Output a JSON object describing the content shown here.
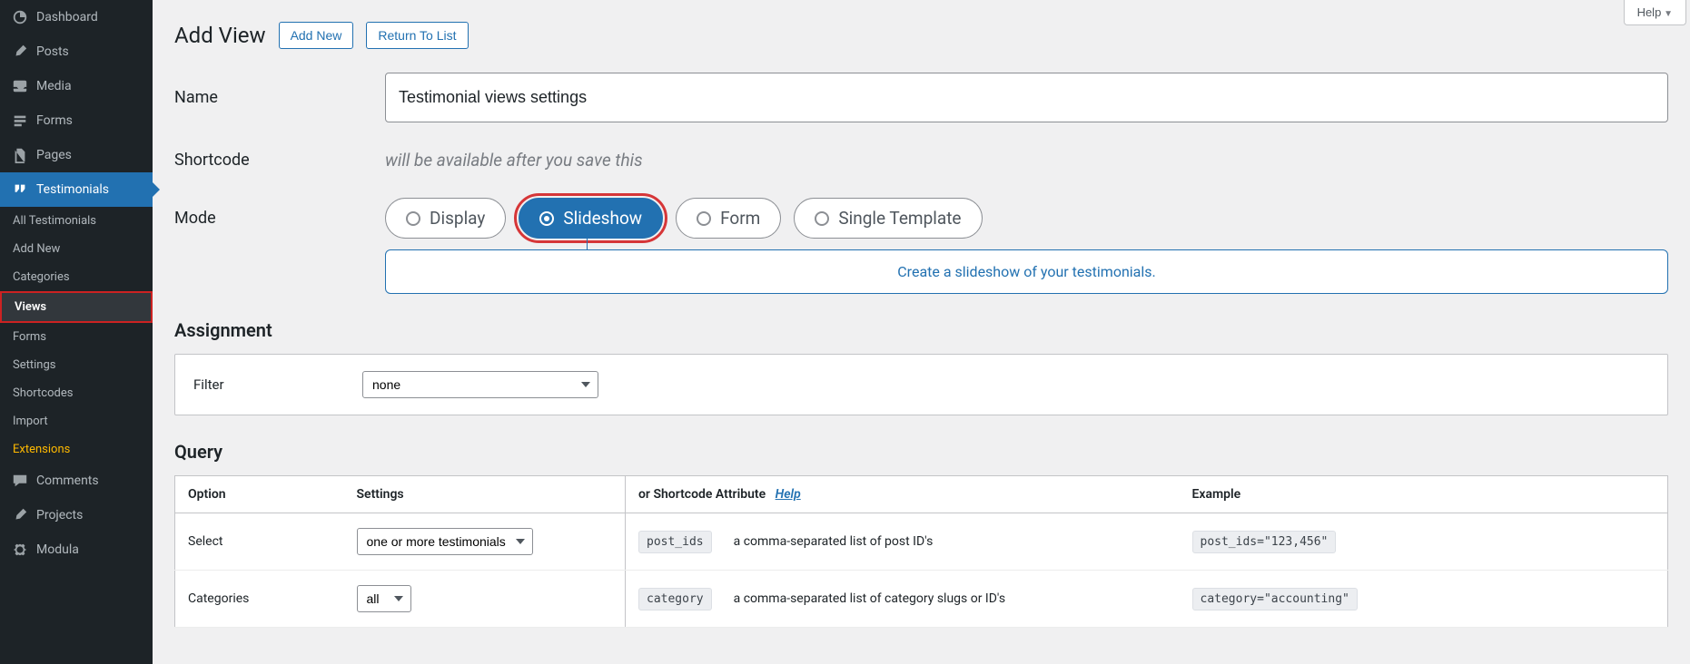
{
  "help_button": "Help",
  "sidebar": {
    "top": [
      {
        "icon": "dashboard",
        "label": "Dashboard"
      },
      {
        "icon": "pin",
        "label": "Posts"
      },
      {
        "icon": "media",
        "label": "Media"
      },
      {
        "icon": "forms",
        "label": "Forms"
      },
      {
        "icon": "pages",
        "label": "Pages"
      },
      {
        "icon": "quote",
        "label": "Testimonials"
      }
    ],
    "testimonials_sub": [
      "All Testimonials",
      "Add New",
      "Categories",
      "Views",
      "Forms",
      "Settings",
      "Shortcodes",
      "Import",
      "Extensions"
    ],
    "bottom": [
      {
        "icon": "comment",
        "label": "Comments"
      },
      {
        "icon": "pin",
        "label": "Projects"
      },
      {
        "icon": "gear",
        "label": "Modula"
      }
    ]
  },
  "header": {
    "title": "Add View",
    "add_new": "Add New",
    "return": "Return To List"
  },
  "name": {
    "label": "Name",
    "value": "Testimonial views settings"
  },
  "shortcode": {
    "label": "Shortcode",
    "msg": "will be available after you save this"
  },
  "mode": {
    "label": "Mode",
    "options": [
      "Display",
      "Slideshow",
      "Form",
      "Single Template"
    ],
    "selected": "Slideshow",
    "desc": "Create a slideshow of your testimonials."
  },
  "assignment": {
    "title": "Assignment",
    "filter_label": "Filter",
    "filter_value": "none"
  },
  "query": {
    "title": "Query",
    "headers": {
      "option": "Option",
      "settings": "Settings",
      "shortcode": "or Shortcode Attribute",
      "help": "Help",
      "example": "Example"
    },
    "rows": [
      {
        "option": "Select",
        "settings_value": "one or more testimonials",
        "attr": "post_ids",
        "desc": "a comma-separated list of post ID's",
        "example": "post_ids=\"123,456\""
      },
      {
        "option": "Categories",
        "settings_value": "all",
        "attr": "category",
        "desc": "a comma-separated list of category slugs or ID's",
        "example": "category=\"accounting\""
      }
    ]
  }
}
